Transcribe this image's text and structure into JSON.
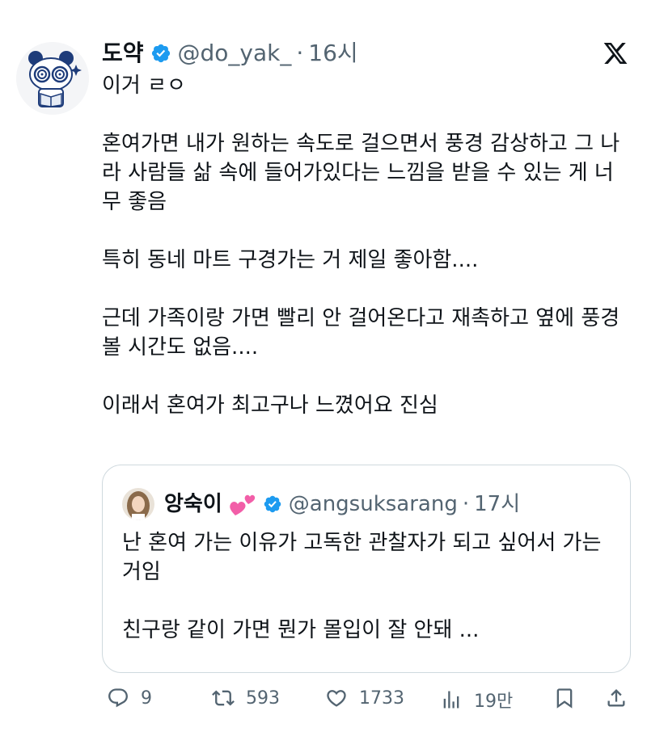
{
  "tweet": {
    "author": {
      "display_name": "도약",
      "handle": "@do_yak_",
      "avatar_icon": "panda-avatar-icon",
      "verified_icon": "verified-badge-icon"
    },
    "separator": "·",
    "time": "16시",
    "platform_icon": "x-logo-icon",
    "text_paragraphs": [
      "이거 ㄹㅇ",
      "혼여가면 내가 원하는 속도로 걸으면서 풍경 감상하고 그 나라 사람들 삶 속에 들어가있다는 느낌을 받을 수 있는 게 너무 좋음",
      "특히 동네 마트 구경가는 거 제일 좋아함....",
      "근데 가족이랑 가면 빨리 안 걸어온다고 재촉하고 옆에 풍경 볼 시간도 없음....",
      "이래서 혼여가 최고구나 느꼈어요 진심"
    ]
  },
  "quote": {
    "author": {
      "display_name": "앙숙이",
      "name_emoji": "two-hearts-icon",
      "handle": "@angsuksarang",
      "verified_icon": "verified-badge-icon"
    },
    "separator": "·",
    "time": "17시",
    "text_paragraphs": [
      "난 혼여 가는 이유가 고독한 관찰자가 되고 싶어서 가는 거임",
      "친구랑 같이 가면 뭔가 몰입이 잘 안돼 ..."
    ]
  },
  "actions": {
    "reply": {
      "icon": "reply-icon",
      "count": "9"
    },
    "retweet": {
      "icon": "retweet-icon",
      "count": "593"
    },
    "like": {
      "icon": "heart-icon",
      "count": "1733"
    },
    "views": {
      "icon": "views-icon",
      "count": "19만"
    },
    "bookmark": {
      "icon": "bookmark-icon"
    },
    "share": {
      "icon": "share-icon"
    }
  },
  "colors": {
    "text": "#0f1419",
    "secondary": "#536471",
    "verified": "#1d9bf0",
    "border": "#cfd9de",
    "heart_emoji": "#f25ea8"
  }
}
